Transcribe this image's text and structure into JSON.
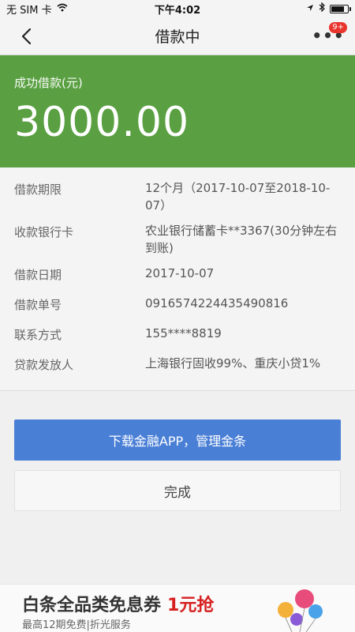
{
  "status_bar": {
    "carrier": "无 SIM 卡",
    "time": "下午4:02",
    "battery_level": 0.85
  },
  "nav": {
    "title": "借款中",
    "more_badge": "9+"
  },
  "amount_card": {
    "label": "成功借款(元)",
    "value": "3000.00",
    "background_color": "#5aa042"
  },
  "details": [
    {
      "label": "借款期限",
      "value": "12个月（2017-10-07至2018-10-07）"
    },
    {
      "label": "收款银行卡",
      "value": "农业银行储蓄卡**3367(30分钟左右到账)"
    },
    {
      "label": "借款日期",
      "value": "2017-10-07"
    },
    {
      "label": "借款单号",
      "value": "0916574224435490816"
    },
    {
      "label": "联系方式",
      "value": "155****8819"
    },
    {
      "label": "贷款发放人",
      "value": "上海银行固收99%、重庆小贷1%"
    }
  ],
  "actions": {
    "primary_label": "下载金融APP，管理金条",
    "secondary_label": "完成",
    "primary_color": "#4a7fd6"
  },
  "promo": {
    "title": "白条全品类免息券",
    "highlight": "1元抢",
    "subtitle": "最高12期免费|折光服务"
  }
}
